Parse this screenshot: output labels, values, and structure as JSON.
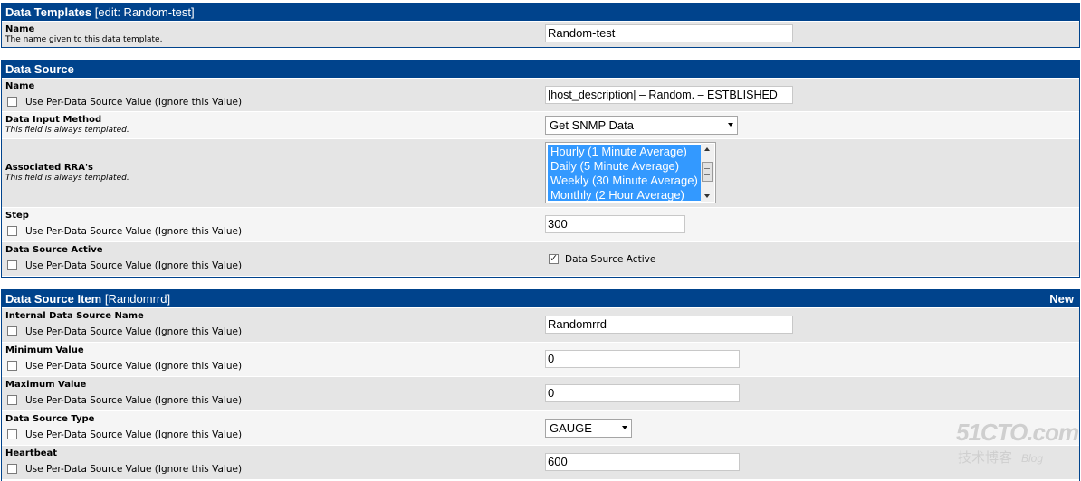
{
  "templates": {
    "title": "Data Templates",
    "title_suffix": "[edit: Random-test]",
    "name_label": "Name",
    "name_desc": "The name given to this data template.",
    "name_value": "Random-test"
  },
  "source": {
    "title": "Data Source",
    "checkbox_label": "Use Per-Data Source Value (Ignore this Value)",
    "name_label": "Name",
    "name_value": "|host_description| – Random. – ESTBLISHED",
    "input_method_label": "Data Input Method",
    "always_templated": "This field is always templated.",
    "input_method_value": "Get SNMP Data",
    "rra_label": "Associated RRA's",
    "rra_options": [
      "Hourly (1 Minute Average)",
      "Daily (5 Minute Average)",
      "Weekly (30 Minute Average)",
      "Monthly (2 Hour Average)"
    ],
    "step_label": "Step",
    "step_value": "300",
    "active_label": "Data Source Active",
    "active_checkbox_label": "Data Source Active"
  },
  "item": {
    "title": "Data Source Item",
    "title_suffix": "[Randomrrd]",
    "new_label": "New",
    "internal_name_label": "Internal Data Source Name",
    "internal_name_value": "Randomrrd",
    "min_label": "Minimum Value",
    "min_value": "0",
    "max_label": "Maximum Value",
    "max_value": "0",
    "type_label": "Data Source Type",
    "type_value": "GAUGE",
    "heartbeat_label": "Heartbeat",
    "heartbeat_value": "600"
  },
  "watermark": {
    "brand": "51CTO.com",
    "sub": "技术博客",
    "blog": "Blog"
  }
}
